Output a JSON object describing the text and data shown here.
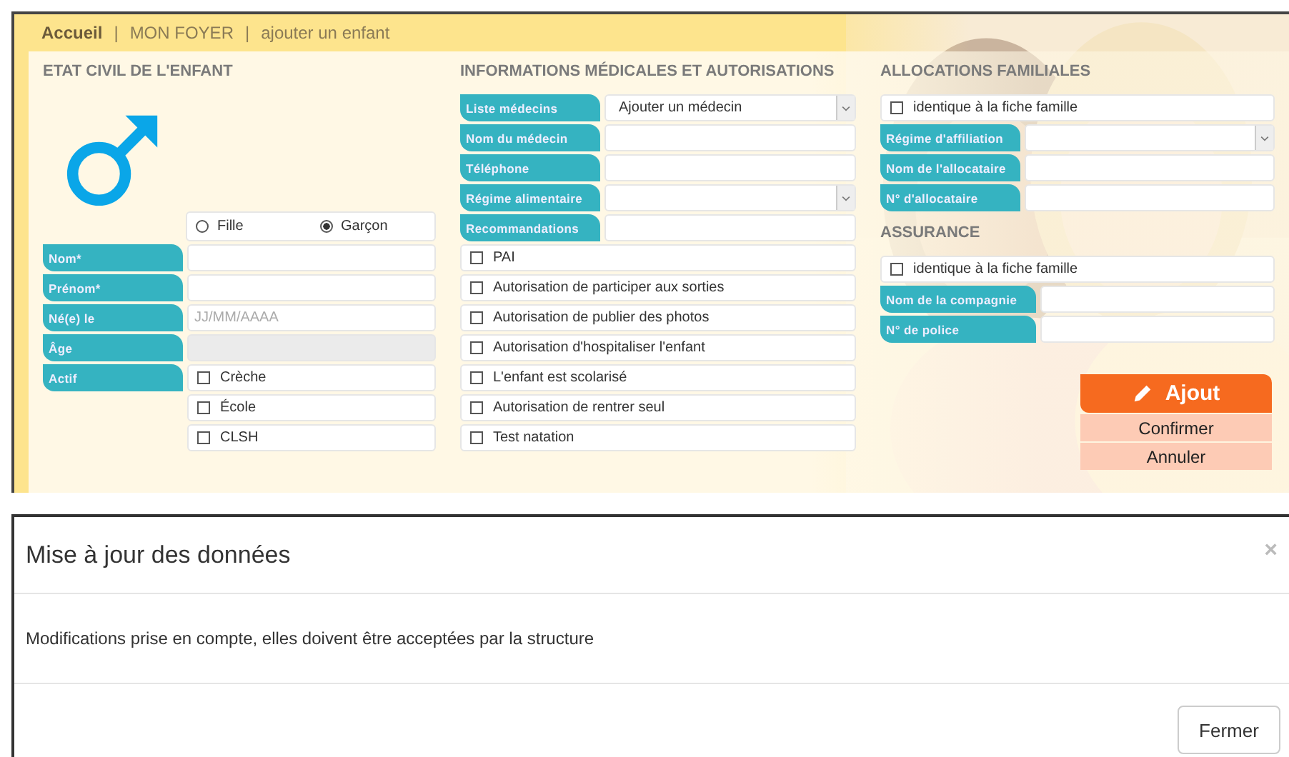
{
  "breadcrumb": [
    {
      "label": "Accueil",
      "selected": true
    },
    {
      "label": "MON FOYER",
      "selected": false
    },
    {
      "label": "ajouter un enfant",
      "selected": false
    }
  ],
  "breadcrumb_separator": "|",
  "etat_civil": {
    "heading": "ETAT CIVIL DE L'ENFANT",
    "gender": [
      {
        "label": "Fille",
        "selected": false
      },
      {
        "label": "Garçon",
        "selected": true
      }
    ],
    "fields": [
      {
        "label": "Nom*",
        "kind": "text",
        "disabled": false
      },
      {
        "label": "Prénom*",
        "kind": "text",
        "disabled": false
      },
      {
        "label": "Né(e) le",
        "kind": "text",
        "placeholder": "JJ/MM/AAAA",
        "disabled": false
      },
      {
        "label": "Âge",
        "kind": "readonly",
        "disabled": false
      },
      {
        "label": "Actif",
        "kind": "checks",
        "disabled": false,
        "options": [
          {
            "label": "Crèche",
            "checked": false
          },
          {
            "label": "École",
            "checked": false
          },
          {
            "label": "CLSH",
            "checked": false
          }
        ]
      }
    ]
  },
  "medical": {
    "heading": "INFORMATIONS MÉDICALES ET AUTORISATIONS",
    "fields": [
      {
        "label": "Liste médecins",
        "kind": "select",
        "value": "Ajouter un médecin",
        "disabled": false
      },
      {
        "label": "Nom du médecin",
        "kind": "text",
        "disabled": false
      },
      {
        "label": "Téléphone",
        "kind": "text",
        "disabled": false
      },
      {
        "label": "Régime alimentaire",
        "kind": "select",
        "disabled": false
      },
      {
        "label": "Recommandations",
        "kind": "text",
        "disabled": false
      }
    ],
    "checkboxes": [
      {
        "label": "PAI",
        "checked": false
      },
      {
        "label": "Autorisation de participer aux sorties",
        "checked": false
      },
      {
        "label": "Autorisation de publier des photos",
        "checked": false
      },
      {
        "label": "Autorisation d'hospitaliser l'enfant",
        "checked": false
      },
      {
        "label": "L'enfant est scolarisé",
        "checked": false
      },
      {
        "label": "Autorisation de rentrer seul",
        "checked": false
      },
      {
        "label": "Test natation",
        "checked": false
      }
    ]
  },
  "allocations": {
    "heading": "ALLOCATIONS FAMILIALES",
    "same_as_family": {
      "label": "identique à la fiche famille",
      "checked": false
    },
    "fields": [
      {
        "label": "Régime d'affiliation",
        "kind": "select",
        "disabled": false
      },
      {
        "label": "Nom de l'allocataire",
        "kind": "text",
        "disabled": false
      },
      {
        "label": "N° d'allocataire",
        "kind": "text",
        "disabled": false
      }
    ]
  },
  "assurance": {
    "heading": "ASSURANCE",
    "same_as_family": {
      "label": "identique à la fiche famille",
      "checked": false
    },
    "fields": [
      {
        "label": "Nom de la compagnie",
        "kind": "text",
        "disabled": false
      },
      {
        "label": "N° de police",
        "kind": "text",
        "disabled": false
      }
    ]
  },
  "actions": {
    "add": "Ajout",
    "confirm": "Confirmer",
    "cancel": "Annuler"
  },
  "dialog": {
    "title": "Mise à jour des données",
    "close": "×",
    "message": "Modifications prise en compte, elles doivent être acceptées par la structure",
    "button": "Fermer"
  }
}
